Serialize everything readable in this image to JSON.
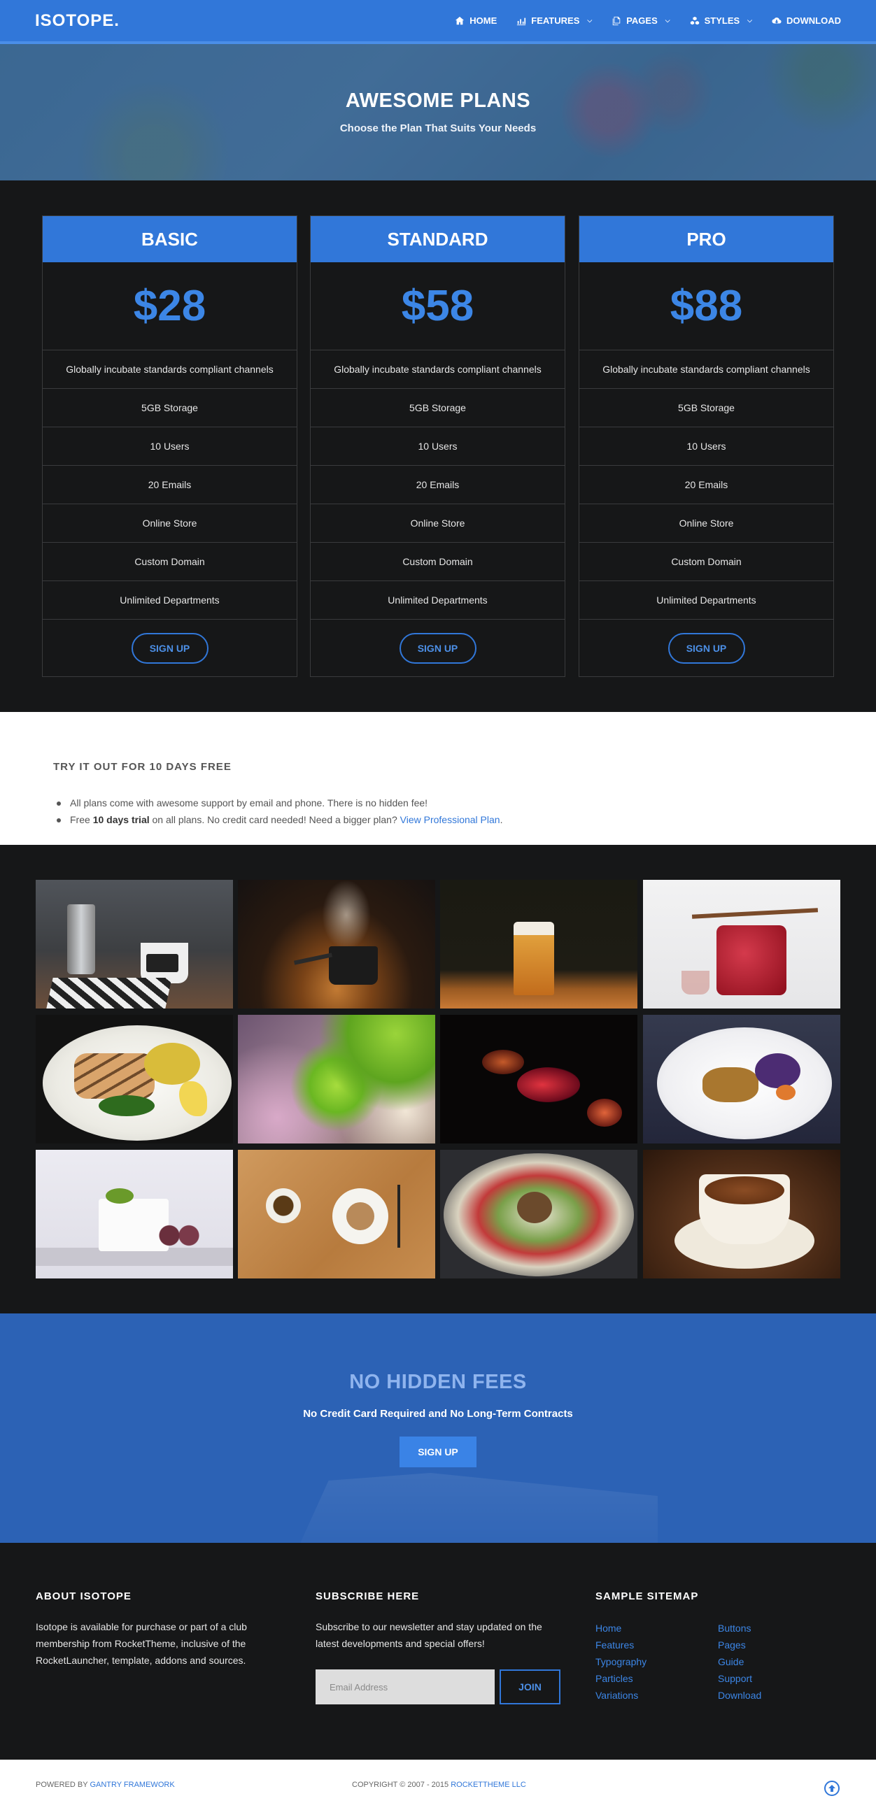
{
  "header": {
    "logo": "ISOTOPE.",
    "nav": [
      {
        "label": "HOME",
        "icon": "home-icon",
        "dropdown": false
      },
      {
        "label": "FEATURES",
        "icon": "bar-chart-icon",
        "dropdown": true
      },
      {
        "label": "PAGES",
        "icon": "copy-icon",
        "dropdown": true
      },
      {
        "label": "STYLES",
        "icon": "cubes-icon",
        "dropdown": true
      },
      {
        "label": "DOWNLOAD",
        "icon": "cloud-download-icon",
        "dropdown": false
      }
    ]
  },
  "hero": {
    "title": "AWESOME PLANS",
    "subtitle": "Choose the Plan That Suits Your Needs"
  },
  "plans": [
    {
      "name": "BASIC",
      "price": "$28",
      "features": [
        "Globally incubate standards compliant channels",
        "5GB Storage",
        "10 Users",
        "20 Emails",
        "Online Store",
        "Custom Domain",
        "Unlimited Departments"
      ],
      "button": "SIGN UP"
    },
    {
      "name": "STANDARD",
      "price": "$58",
      "features": [
        "Globally incubate standards compliant channels",
        "5GB Storage",
        "10 Users",
        "20 Emails",
        "Online Store",
        "Custom Domain",
        "Unlimited Departments"
      ],
      "button": "SIGN UP"
    },
    {
      "name": "PRO",
      "price": "$88",
      "features": [
        "Globally incubate standards compliant channels",
        "5GB Storage",
        "10 Users",
        "20 Emails",
        "Online Store",
        "Custom Domain",
        "Unlimited Departments"
      ],
      "button": "SIGN UP"
    }
  ],
  "trial": {
    "title": "TRY IT OUT FOR 10 DAYS FREE",
    "item1": "All plans come with awesome support by email and phone. There is no hidden fee!",
    "item2_pre": "Free ",
    "item2_bold": "10 days trial",
    "item2_mid": " on all plans. No credit card needed! Need a bigger plan? ",
    "item2_link": "View Professional Plan",
    "item2_post": "."
  },
  "gallery": {
    "images": [
      "coffee-pot-and-cup",
      "steaming-pot",
      "beer-glass",
      "honey-jar",
      "grilled-salmon-plate",
      "green-flowers",
      "goldfish",
      "plated-meal-cabbage",
      "dessert-cake",
      "tea-and-cookie",
      "hotpot-bowl",
      "coffee-cup"
    ]
  },
  "cta": {
    "title": "NO HIDDEN FEES",
    "subtitle": "No Credit Card Required and No Long-Term Contracts",
    "button": "SIGN UP"
  },
  "footer": {
    "about_title": "ABOUT ISOTOPE",
    "about_text": "Isotope is available for purchase or part of a club membership from RocketTheme, inclusive of the RocketLauncher, template, addons and sources.",
    "subscribe_title": "SUBSCRIBE HERE",
    "subscribe_text": "Subscribe to our newsletter and stay updated on the latest developments and special offers!",
    "email_placeholder": "Email Address",
    "join_label": "JOIN",
    "sitemap_title": "SAMPLE SITEMAP",
    "sitemap_col1": [
      "Home",
      "Features",
      "Typography",
      "Particles",
      "Variations"
    ],
    "sitemap_col2": [
      "Buttons",
      "Pages",
      "Guide",
      "Support",
      "Download"
    ]
  },
  "bottom": {
    "powered_prefix": "POWERED BY ",
    "powered_link": "GANTRY FRAMEWORK",
    "copyright_prefix": "COPYRIGHT © 2007 - 2015 ",
    "copyright_link": "ROCKETTHEME LLC"
  },
  "colors": {
    "brand_blue": "#3177d9",
    "dark_bg": "#161718",
    "cta_bg": "#2c62b5"
  }
}
